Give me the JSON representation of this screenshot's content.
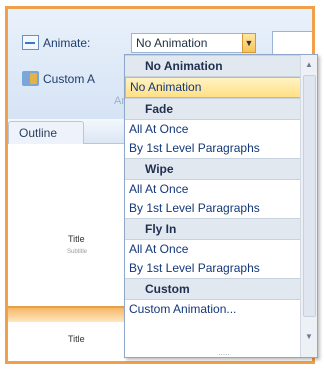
{
  "ribbon": {
    "animate_label": "Animate:",
    "custom_label": "Custom A",
    "combo_value": "No Animation",
    "group_caption": "Ani"
  },
  "tabs": {
    "outline_label": "Outline"
  },
  "slides": [
    {
      "title": "Title",
      "subtitle": "Subtitle"
    },
    {
      "title": "Title"
    }
  ],
  "dropdown": {
    "sections": [
      {
        "header": "No Animation",
        "items": [
          "No Animation"
        ],
        "selected_index": 0
      },
      {
        "header": "Fade",
        "items": [
          "All At Once",
          "By 1st Level Paragraphs"
        ]
      },
      {
        "header": "Wipe",
        "items": [
          "All At Once",
          "By 1st Level Paragraphs"
        ]
      },
      {
        "header": "Fly In",
        "items": [
          "All At Once",
          "By 1st Level Paragraphs"
        ]
      },
      {
        "header": "Custom",
        "items": [
          "Custom Animation..."
        ]
      }
    ],
    "grip": "....."
  },
  "icons": {
    "animate": "animate-icon",
    "custom_animation": "custom-animation-icon",
    "dropdown_arrow": "chevron-down-icon"
  },
  "colors": {
    "frame_border": "#f0a04a",
    "selected_fill": "#ffdf86",
    "item_text": "#14387a"
  }
}
